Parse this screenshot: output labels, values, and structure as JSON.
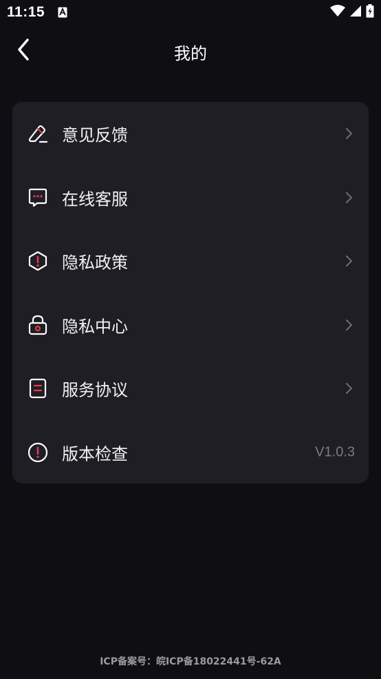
{
  "status_bar": {
    "time": "11:15",
    "notification_icon": "a-icon",
    "icons": [
      "wifi-icon",
      "signal-icon",
      "battery-charging-icon"
    ]
  },
  "header": {
    "back_icon": "chevron-left-icon",
    "title": "我的"
  },
  "menu": {
    "items": [
      {
        "label": "意见反馈",
        "icon": "edit-feedback-icon",
        "trailing": "chevron-right-icon"
      },
      {
        "label": "在线客服",
        "icon": "chat-bubble-icon",
        "trailing": "chevron-right-icon"
      },
      {
        "label": "隐私政策",
        "icon": "shield-alert-icon",
        "trailing": "chevron-right-icon"
      },
      {
        "label": "隐私中心",
        "icon": "lock-icon",
        "trailing": "chevron-right-icon"
      },
      {
        "label": "服务协议",
        "icon": "document-icon",
        "trailing": "chevron-right-icon"
      },
      {
        "label": "版本检查",
        "icon": "info-circle-icon",
        "value": "V1.0.3"
      }
    ]
  },
  "footer": {
    "icp": "ICP备案号：皖ICP备18022441号-62A"
  },
  "colors": {
    "background": "#0f0f13",
    "card": "#1e1e24",
    "accent": "#e8384f",
    "text": "#f2f2f2",
    "muted": "#7b7b82"
  }
}
